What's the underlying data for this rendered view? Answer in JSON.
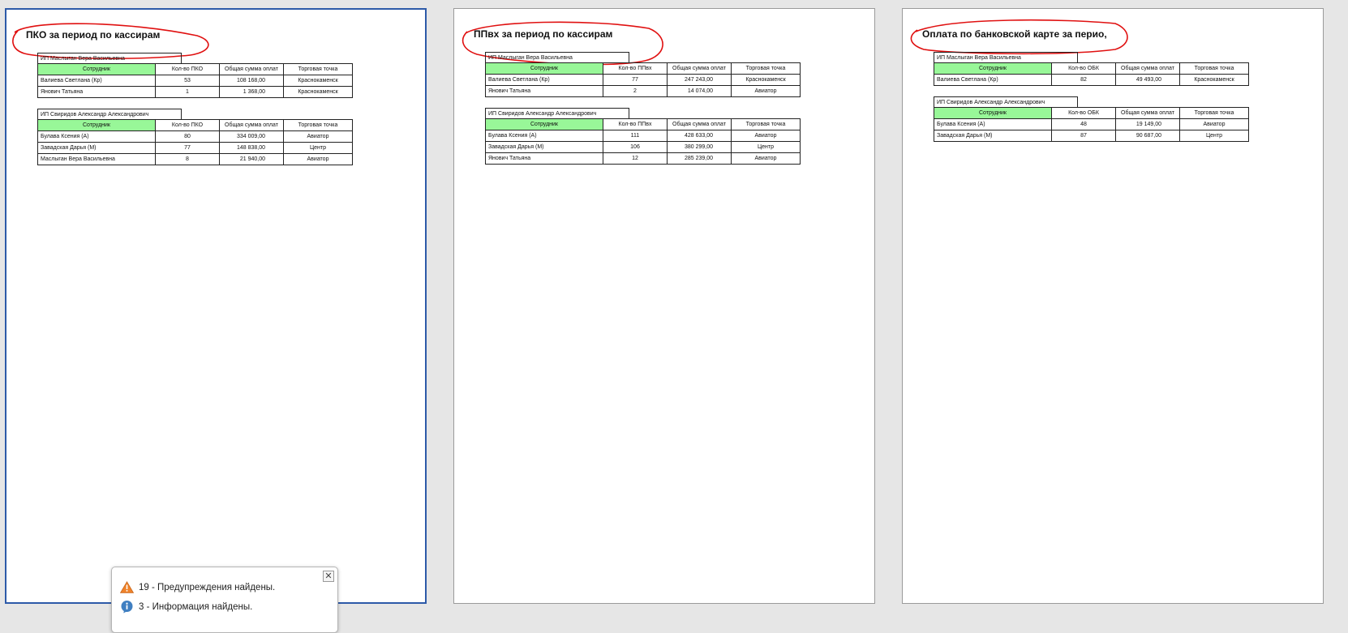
{
  "pages": [
    {
      "title": "ПКО за период по кассирам",
      "groups": [
        {
          "name": "ИП Маслыган Вера Васильевна",
          "headers": [
            "Сотрудник",
            "Кол-во ПКО",
            "Общая сумма оплат",
            "Торговая точка"
          ],
          "rows": [
            [
              "Валиева Светлана (Кр)",
              "53",
              "108 168,00",
              "Краснокаменск"
            ],
            [
              "Янович Татьяна",
              "1",
              "1 368,00",
              "Краснокаменск"
            ]
          ]
        },
        {
          "name": "ИП Свиридов Александр Александрович",
          "headers": [
            "Сотрудник",
            "Кол-во ПКО",
            "Общая сумма оплат",
            "Торговая точка"
          ],
          "rows": [
            [
              "Булава Ксения (А)",
              "80",
              "334 009,00",
              "Авиатор"
            ],
            [
              "Завадская Дарья (М)",
              "77",
              "148 838,00",
              "Центр"
            ],
            [
              "Маслыган Вера Васильевна",
              "8",
              "21 940,00",
              "Авиатор"
            ]
          ]
        }
      ]
    },
    {
      "title": "ППвх за период по кассирам",
      "groups": [
        {
          "name": "ИП Маслыган Вера Васильевна",
          "headers": [
            "Сотрудник",
            "Кол-во ППвх",
            "Общая сумма оплат",
            "Торговая точка"
          ],
          "rows": [
            [
              "Валиева Светлана (Кр)",
              "77",
              "247 243,00",
              "Краснокаменск"
            ],
            [
              "Янович Татьяна",
              "2",
              "14 074,00",
              "Авиатор"
            ]
          ]
        },
        {
          "name": "ИП Свиридов Александр Александрович",
          "headers": [
            "Сотрудник",
            "Кол-во ППвх",
            "Общая сумма оплат",
            "Торговая точка"
          ],
          "rows": [
            [
              "Булава Ксения (А)",
              "111",
              "428 633,00",
              "Авиатор"
            ],
            [
              "Завадская Дарья (М)",
              "106",
              "380 299,00",
              "Центр"
            ],
            [
              "Янович Татьяна",
              "12",
              "285 239,00",
              "Авиатор"
            ]
          ]
        }
      ]
    },
    {
      "title": "Оплата по банковской карте за перио,",
      "groups": [
        {
          "name": "ИП Маслыган Вера Васильевна",
          "headers": [
            "Сотрудник",
            "Кол-во ОБК",
            "Общая сумма оплат",
            "Торговая точка"
          ],
          "rows": [
            [
              "Валиева Светлана (Кр)",
              "82",
              "49 493,00",
              "Краснокаменск"
            ]
          ]
        },
        {
          "name": "ИП Свиридов Александр Александрович",
          "headers": [
            "Сотрудник",
            "Кол-во ОБК",
            "Общая сумма оплат",
            "Торговая точка"
          ],
          "rows": [
            [
              "Булава Ксения (А)",
              "48",
              "19 149,00",
              "Авиатор"
            ],
            [
              "Завадская Дарья (М)",
              "87",
              "90 687,00",
              "Центр"
            ]
          ]
        }
      ]
    }
  ],
  "popup": {
    "warning_text": "19 - Предупреждения найдены.",
    "info_text": "3 - Информация найдены.",
    "close_glyph": "✕",
    "warning_icon": "warning-icon",
    "info_icon": "info-icon"
  },
  "colors": {
    "header_employee_bg": "#98f798",
    "annotation_red": "#e01010",
    "selected_page_border": "#2d5aa8"
  }
}
